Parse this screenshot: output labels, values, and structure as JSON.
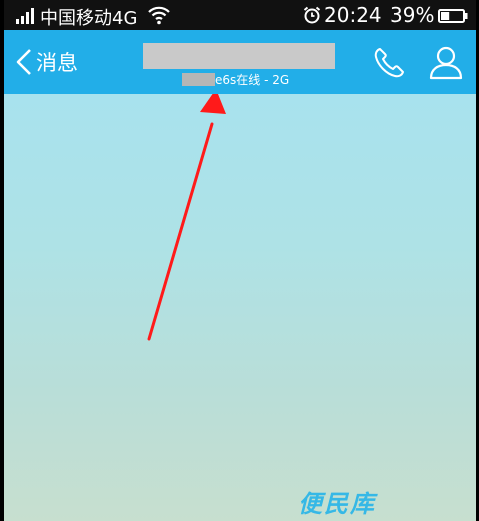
{
  "status_bar": {
    "carrier": "中国移动4G",
    "time": "20:24",
    "battery_percent": "39%",
    "battery_level": 0.39,
    "icons": [
      "signal-icon",
      "wifi-icon",
      "alarm-icon",
      "battery-icon"
    ]
  },
  "title_bar": {
    "back_label": "消息",
    "subtitle": "e6s在线 - 2G",
    "icons": [
      "back-chevron-icon",
      "phone-icon",
      "profile-icon"
    ],
    "background_color": "#22aee8"
  },
  "watermark": {
    "text": "便民库"
  },
  "annotation": {
    "icon": "red-arrow-icon",
    "color": "#ff1a1a"
  }
}
